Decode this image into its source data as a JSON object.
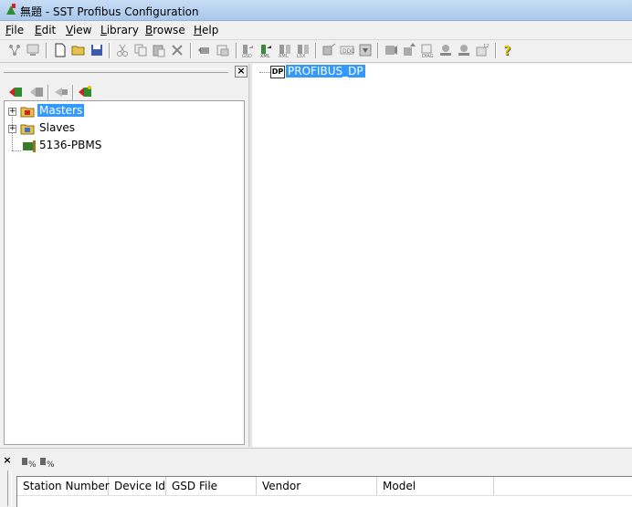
{
  "window": {
    "title": "無題 - SST Profibus Configuration",
    "app_icon": "tree-config-icon"
  },
  "menu": [
    {
      "label": "File",
      "key": "F",
      "rest": "ile"
    },
    {
      "label": "Edit",
      "key": "E",
      "rest": "dit"
    },
    {
      "label": "View",
      "key": "V",
      "rest": "iew"
    },
    {
      "label": "Library",
      "key": "L",
      "rest": "ibrary"
    },
    {
      "label": "Browse",
      "key": "B",
      "rest": "rowse"
    },
    {
      "label": "Help",
      "key": "H",
      "rest": "elp"
    }
  ],
  "toolbar": {
    "icons": [
      "network-icon",
      "monitor-icon",
      "new-file-icon",
      "open-folder-icon",
      "save-icon",
      "cut-icon",
      "copy-icon",
      "paste-icon",
      "delete-icon",
      "move-left-icon",
      "move-right-icon",
      "import-icon",
      "export-xml-icon",
      "export-lsx-icon",
      "compare-icon",
      "connect-icon",
      "online-icon",
      "download-icon",
      "card-icon",
      "upload-icon",
      "diagnostics-icon",
      "device-icon",
      "device-alt-icon",
      "properties-icon",
      "help-icon"
    ]
  },
  "library": {
    "close_label": "×",
    "tree": [
      {
        "label": "Masters",
        "icon": "folder-master-icon",
        "selected": true
      },
      {
        "label": "Slaves",
        "icon": "folder-slave-icon",
        "selected": false
      },
      {
        "label": "5136-PBMS",
        "icon": "card-device-icon",
        "selected": false
      }
    ]
  },
  "network": {
    "root": {
      "label": "PROFIBUS_DP",
      "icon_text": "DP",
      "selected": true
    }
  },
  "bottom": {
    "close_label": "×",
    "columns": [
      "Station Number",
      "Device Id",
      "GSD File",
      "Vendor",
      "Model"
    ]
  },
  "colors": {
    "selection": "#3399ff",
    "title_gradient_top": "#c7ddf5",
    "title_gradient_bottom": "#a9c8ec"
  }
}
